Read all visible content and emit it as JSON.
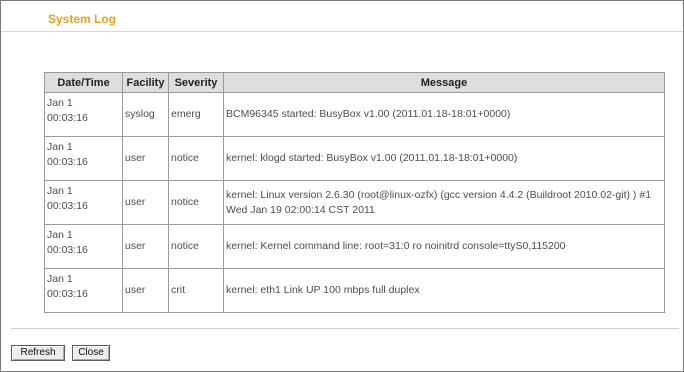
{
  "header": {
    "title": "System Log"
  },
  "table": {
    "columns": [
      "Date/Time",
      "Facility",
      "Severity",
      "Message"
    ],
    "rows": [
      {
        "date": "Jan 1",
        "time": "00:03:16",
        "facility": "syslog",
        "severity": "emerg",
        "message": "BCM96345 started: BusyBox v1.00 (2011.01.18-18:01+0000)"
      },
      {
        "date": "Jan 1",
        "time": "00:03:16",
        "facility": "user",
        "severity": "notice",
        "message": "kernel: klogd started: BusyBox v1.00 (2011.01.18-18:01+0000)"
      },
      {
        "date": "Jan 1",
        "time": "00:03:16",
        "facility": "user",
        "severity": "notice",
        "message": "kernel: Linux version 2.6.30 (root@linux-ozfx) (gcc version 4.4.2 (Buildroot 2010.02-git) ) #1 Wed Jan 19 02:00:14 CST 2011"
      },
      {
        "date": "Jan 1",
        "time": "00:03:16",
        "facility": "user",
        "severity": "notice",
        "message": "kernel: Kernel command line: root=31:0 ro noinitrd console=ttyS0,115200"
      },
      {
        "date": "Jan 1",
        "time": "00:03:16",
        "facility": "user",
        "severity": "crit",
        "message": "kernel: eth1 Link UP 100 mbps full duplex"
      }
    ]
  },
  "buttons": {
    "refresh_label": "Refresh",
    "close_label": "Close"
  },
  "colors": {
    "title": "#e8a020",
    "header_bg": "#dedede",
    "border": "#9a9a9a"
  }
}
